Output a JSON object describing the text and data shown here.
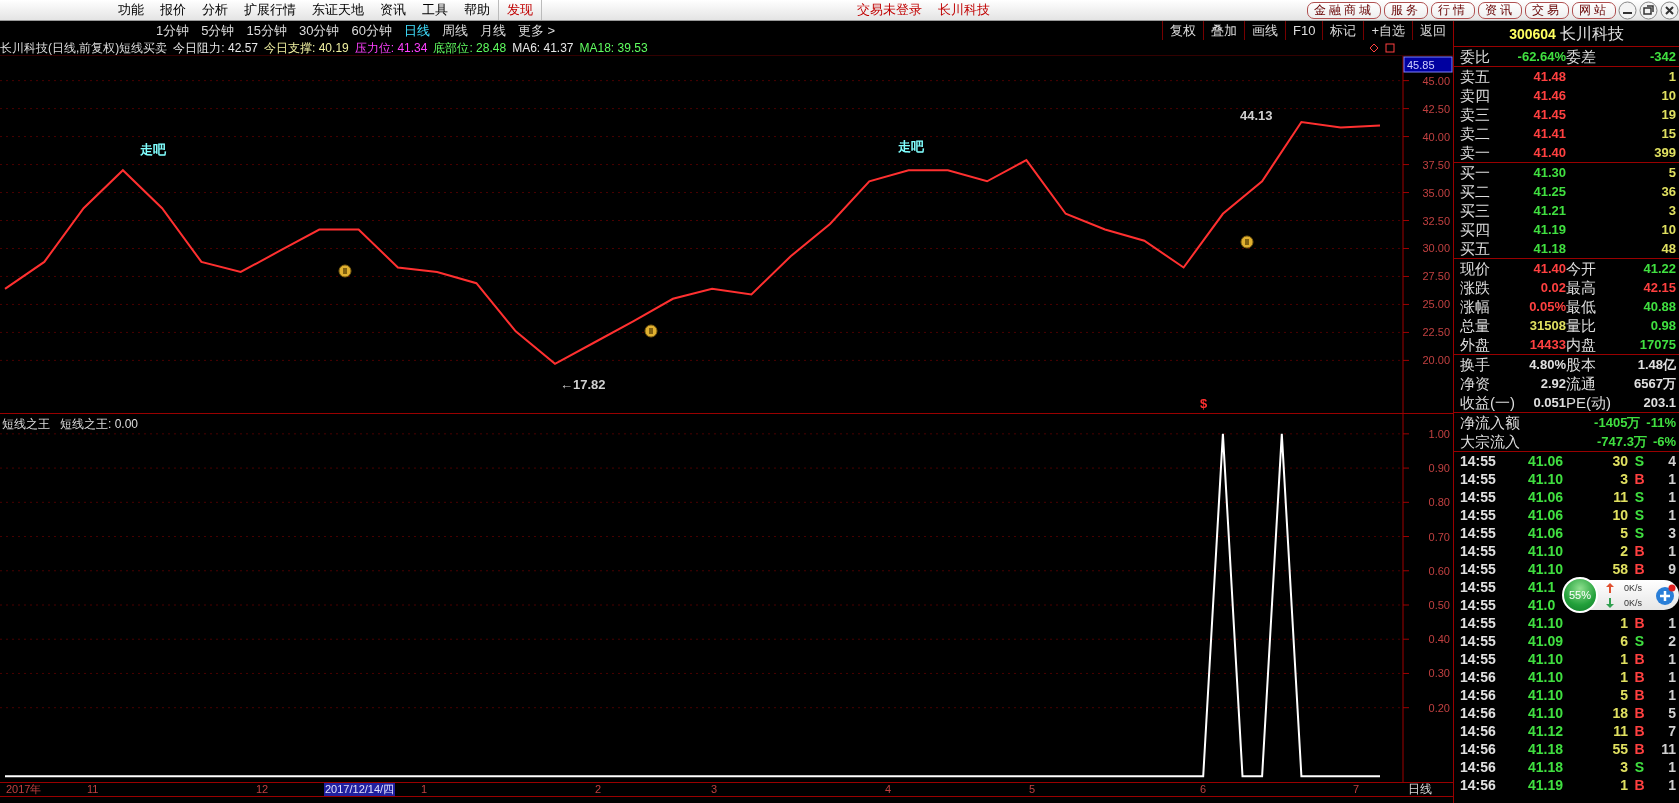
{
  "menu": {
    "items": [
      {
        "label": "功能",
        "kind": "menu"
      },
      {
        "label": "报价",
        "kind": "menu"
      },
      {
        "label": "分析",
        "kind": "menu"
      },
      {
        "label": "扩展行情",
        "kind": "menu"
      },
      {
        "label": "东证天地",
        "kind": "menu"
      },
      {
        "label": "资讯",
        "kind": "menu"
      },
      {
        "label": "工具",
        "kind": "menu"
      },
      {
        "label": "帮助",
        "kind": "menu"
      },
      {
        "label": "发现",
        "kind": "highlight"
      }
    ],
    "status": [
      "交易未登录",
      "长川科技"
    ],
    "buttons": [
      "金融商城",
      "服务",
      "行情",
      "资讯",
      "交易",
      "网站"
    ]
  },
  "periods": [
    {
      "label": "1分钟",
      "selected": false
    },
    {
      "label": "5分钟",
      "selected": false
    },
    {
      "label": "15分钟",
      "selected": false
    },
    {
      "label": "30分钟",
      "selected": false
    },
    {
      "label": "60分钟",
      "selected": false
    },
    {
      "label": "日线",
      "selected": true
    },
    {
      "label": "周线",
      "selected": false
    },
    {
      "label": "月线",
      "selected": false
    },
    {
      "label": "更多 >",
      "selected": false
    }
  ],
  "toolbar_buttons": [
    "复权",
    "叠加",
    "画线",
    "F10",
    "标记",
    "+自选",
    "返回"
  ],
  "info_line": {
    "title": "长川科技(日线,前复权)短线买卖",
    "items": [
      {
        "text": "今日阻力: 42.57",
        "color": "#e8e8e8"
      },
      {
        "text": "今日支撑: 40.19",
        "color": "#f0f0a0"
      },
      {
        "text": "压力位: 41.34",
        "color": "#ff40ff"
      },
      {
        "text": "底部位: 28.48",
        "color": "#60ff60"
      },
      {
        "text": "MA6: 41.37",
        "color": "#e8e8e8"
      },
      {
        "text": "MA18: 39.53",
        "color": "#60ff60"
      }
    ]
  },
  "main_chart": {
    "cursor_price": "45.85",
    "labels": [
      {
        "text": "走吧",
        "color": "#80ffff"
      },
      {
        "text": "走吧",
        "color": "#80ffff"
      },
      {
        "text": "44.13",
        "color": "#d0d0d0"
      },
      {
        "text": "←17.82",
        "color": "#d0d0d0"
      },
      {
        "text": "$",
        "color": "#ff3030"
      }
    ],
    "chart_data": {
      "type": "line",
      "categories": [
        null,
        null,
        null,
        null,
        null,
        null,
        null,
        null,
        null,
        null,
        null,
        null,
        null,
        null,
        null,
        null,
        null,
        null,
        null,
        null,
        null,
        null,
        null,
        null,
        null,
        null,
        null,
        null,
        null,
        null,
        null,
        null,
        null,
        null,
        null,
        null
      ],
      "series": [
        {
          "color": "#ff3030",
          "values": [
            26.4,
            28.8,
            33.6,
            37.0,
            33.6,
            28.8,
            27.9,
            29.8,
            31.7,
            31.7,
            28.3,
            27.9,
            26.9,
            22.6,
            19.7,
            21.6,
            23.5,
            25.5,
            26.4,
            25.9,
            29.3,
            32.2,
            36.0,
            37.0,
            37.0,
            36.0,
            37.9,
            33.1,
            31.7,
            30.7,
            28.3,
            33.1,
            36.0,
            41.3,
            40.8,
            41.0
          ]
        }
      ],
      "ylim": [
        15.3,
        47.2
      ],
      "grid": true,
      "yticks": [
        {
          "value": 20,
          "label": "20.00"
        },
        {
          "value": 22.5,
          "label": "22.50"
        },
        {
          "value": 25,
          "label": "25.00"
        },
        {
          "value": 27.5,
          "label": "27.50"
        },
        {
          "value": 30,
          "label": "30.00"
        },
        {
          "value": 32.5,
          "label": "32.50"
        },
        {
          "value": 35,
          "label": "35.00"
        },
        {
          "value": 37.5,
          "label": "37.50"
        },
        {
          "value": 40,
          "label": "40.00"
        },
        {
          "value": 42.5,
          "label": "42.50"
        },
        {
          "value": 45,
          "label": "45.00"
        }
      ]
    }
  },
  "indicator": {
    "title": "短线之王",
    "reading": "短线之王: 0.00",
    "chart_data": {
      "type": "line",
      "categories": [
        null,
        null,
        null,
        null,
        null,
        null,
        null,
        null,
        null,
        null,
        null,
        null,
        null,
        null,
        null,
        null,
        null,
        null,
        null,
        null,
        null,
        null,
        null,
        null,
        null,
        null,
        null,
        null,
        null,
        null,
        null,
        null,
        null,
        null,
        null,
        null,
        null,
        null,
        null,
        null,
        null,
        null,
        null,
        null,
        null,
        null,
        null,
        null,
        null,
        null,
        null,
        null,
        null,
        null,
        null,
        null,
        null,
        null,
        null,
        null,
        null,
        null,
        null,
        null,
        null,
        null,
        null,
        null,
        null,
        null,
        null
      ],
      "series": [
        {
          "color": "#ffffff",
          "values": [
            0,
            0,
            0,
            0,
            0,
            0,
            0,
            0,
            0,
            0,
            0,
            0,
            0,
            0,
            0,
            0,
            0,
            0,
            0,
            0,
            0,
            0,
            0,
            0,
            0,
            0,
            0,
            0,
            0,
            0,
            0,
            0,
            0,
            0,
            0,
            0,
            0,
            0,
            0,
            0,
            0,
            0,
            0,
            0,
            0,
            0,
            0,
            0,
            0,
            0,
            0,
            0,
            0,
            0,
            0,
            0,
            0,
            0,
            0,
            0,
            0,
            0,
            1,
            0,
            0,
            1,
            0,
            0,
            0,
            0,
            0
          ]
        }
      ],
      "ylim": [
        -0.02,
        1.058
      ],
      "grid": true,
      "yticks": [
        {
          "value": 0.2,
          "label": "0.20"
        },
        {
          "value": 0.3,
          "label": "0.30"
        },
        {
          "value": 0.4,
          "label": "0.40"
        },
        {
          "value": 0.5,
          "label": "0.50"
        },
        {
          "value": 0.6,
          "label": "0.60"
        },
        {
          "value": 0.7,
          "label": "0.70"
        },
        {
          "value": 0.8,
          "label": "0.80"
        },
        {
          "value": 0.9,
          "label": "0.90"
        },
        {
          "value": 1.0,
          "label": "1.00"
        }
      ]
    }
  },
  "date_axis": {
    "labels": [
      {
        "label": "2017年",
        "highlighted": false
      },
      {
        "label": "11",
        "highlighted": false
      },
      {
        "label": "12",
        "highlighted": false
      },
      {
        "label": "2017/12/14/四",
        "highlighted": true
      },
      {
        "label": "1",
        "highlighted": false
      },
      {
        "label": "2",
        "highlighted": false
      },
      {
        "label": "3",
        "highlighted": false
      },
      {
        "label": "4",
        "highlighted": false
      },
      {
        "label": "5",
        "highlighted": false
      },
      {
        "label": "6",
        "highlighted": false
      },
      {
        "label": "7",
        "highlighted": false
      }
    ],
    "period": "日线"
  },
  "quote": {
    "code": "300604",
    "name": "长川科技",
    "ratio": [
      {
        "label": "委比",
        "value": "-62.64%",
        "color": "#40e040"
      },
      {
        "label": "委差",
        "value": "-342",
        "color": "#40e040"
      }
    ],
    "asks": [
      {
        "label": "卖五",
        "price": "41.48",
        "volume": "1"
      },
      {
        "label": "卖四",
        "price": "41.46",
        "volume": "10"
      },
      {
        "label": "卖三",
        "price": "41.45",
        "volume": "19"
      },
      {
        "label": "卖二",
        "price": "41.41",
        "volume": "15"
      },
      {
        "label": "卖一",
        "price": "41.40",
        "volume": "399"
      }
    ],
    "bids": [
      {
        "label": "买一",
        "price": "41.30",
        "volume": "5"
      },
      {
        "label": "买二",
        "price": "41.25",
        "volume": "36"
      },
      {
        "label": "买三",
        "price": "41.21",
        "volume": "3"
      },
      {
        "label": "买四",
        "price": "41.19",
        "volume": "10"
      },
      {
        "label": "买五",
        "price": "41.18",
        "volume": "48"
      }
    ],
    "stats": [
      [
        {
          "label": "现价",
          "value": "41.40",
          "color": "#ff4040"
        },
        {
          "label": "今开",
          "value": "41.22",
          "color": "#40e040"
        }
      ],
      [
        {
          "label": "涨跌",
          "value": "0.02",
          "color": "#ff4040"
        },
        {
          "label": "最高",
          "value": "42.15",
          "color": "#ff4040"
        }
      ],
      [
        {
          "label": "涨幅",
          "value": "0.05%",
          "color": "#ff4040"
        },
        {
          "label": "最低",
          "value": "40.88",
          "color": "#40e040"
        }
      ],
      [
        {
          "label": "总量",
          "value": "31508",
          "color": "#e0e060"
        },
        {
          "label": "量比",
          "value": "0.98",
          "color": "#40e040"
        }
      ],
      [
        {
          "label": "外盘",
          "value": "14433",
          "color": "#ff4040"
        },
        {
          "label": "内盘",
          "value": "17075",
          "color": "#40e040"
        }
      ]
    ],
    "fundamentals": [
      [
        {
          "label": "换手",
          "value": "4.80%",
          "color": "#e0e0e0"
        },
        {
          "label": "股本",
          "value": "1.48亿",
          "color": "#e0e0e0"
        }
      ],
      [
        {
          "label": "净资",
          "value": "2.92",
          "color": "#e0e0e0"
        },
        {
          "label": "流通",
          "value": "6567万",
          "color": "#e0e0e0"
        }
      ],
      [
        {
          "label": "收益(一)",
          "value": "0.051",
          "color": "#e0e0e0"
        },
        {
          "label": "PE(动)",
          "value": "203.1",
          "color": "#e0e0e0"
        }
      ]
    ],
    "flows": [
      {
        "label": "净流入额",
        "value": "-1405万",
        "pct": "-11%"
      },
      {
        "label": "大宗流入",
        "value": "-747.3万",
        "pct": "-6%"
      }
    ],
    "trades": [
      {
        "time": "14:55",
        "price": "41.06",
        "volume": "30",
        "side": "S",
        "kind": "sell",
        "count": "4"
      },
      {
        "time": "14:55",
        "price": "41.10",
        "volume": "3",
        "side": "B",
        "kind": "buy",
        "count": "1"
      },
      {
        "time": "14:55",
        "price": "41.06",
        "volume": "11",
        "side": "S",
        "kind": "sell",
        "count": "1"
      },
      {
        "time": "14:55",
        "price": "41.06",
        "volume": "10",
        "side": "S",
        "kind": "sell",
        "count": "1"
      },
      {
        "time": "14:55",
        "price": "41.06",
        "volume": "5",
        "side": "S",
        "kind": "sell",
        "count": "3"
      },
      {
        "time": "14:55",
        "price": "41.10",
        "volume": "2",
        "side": "B",
        "kind": "buy",
        "count": "1"
      },
      {
        "time": "14:55",
        "price": "41.10",
        "volume": "58",
        "side": "B",
        "kind": "buy",
        "count": "9"
      },
      {
        "time": "14:55",
        "price": "41.1"
      },
      {
        "time": "14:55",
        "price": "41.0"
      },
      {
        "time": "14:55",
        "price": "41.10",
        "volume": "1",
        "side": "B",
        "kind": "buy",
        "count": "1"
      },
      {
        "time": "14:55",
        "price": "41.09",
        "volume": "6",
        "side": "S",
        "kind": "sell",
        "count": "2"
      },
      {
        "time": "14:55",
        "price": "41.10",
        "volume": "1",
        "side": "B",
        "kind": "buy",
        "count": "1"
      },
      {
        "time": "14:56",
        "price": "41.10",
        "volume": "1",
        "side": "B",
        "kind": "buy",
        "count": "1"
      },
      {
        "time": "14:56",
        "price": "41.10",
        "volume": "5",
        "side": "B",
        "kind": "buy",
        "count": "1"
      },
      {
        "time": "14:56",
        "price": "41.10",
        "volume": "18",
        "side": "B",
        "kind": "buy",
        "count": "5"
      },
      {
        "time": "14:56",
        "price": "41.12",
        "volume": "11",
        "side": "B",
        "kind": "buy",
        "count": "7"
      },
      {
        "time": "14:56",
        "price": "41.18",
        "volume": "55",
        "side": "B",
        "kind": "buy",
        "count": "11"
      },
      {
        "time": "14:56",
        "price": "41.18",
        "volume": "3",
        "side": "S",
        "kind": "sell",
        "count": "1"
      },
      {
        "time": "14:56",
        "price": "41.19",
        "volume": "1",
        "side": "B",
        "kind": "buy",
        "count": "1"
      }
    ]
  },
  "speed_widget": {
    "percent": "55%",
    "upload": "0K/s",
    "download": "0K/s"
  }
}
